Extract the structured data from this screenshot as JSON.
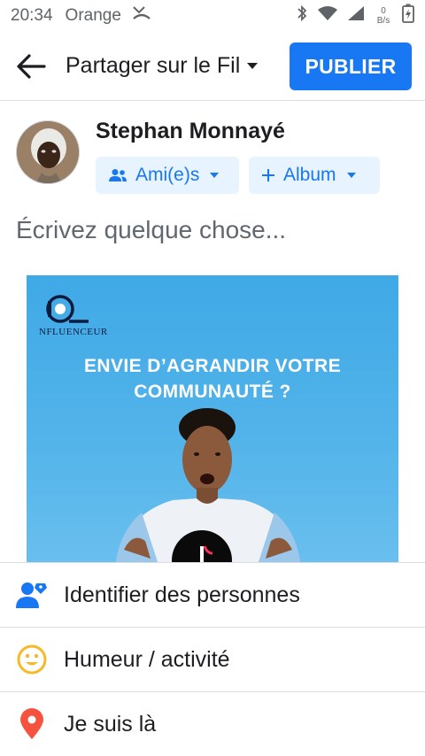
{
  "status_bar": {
    "time": "20:34",
    "carrier": "Orange",
    "net_speed_value": "0",
    "net_speed_unit": "B/s",
    "icons": [
      "missed-call-icon",
      "bluetooth-icon",
      "wifi-icon",
      "signal-icon",
      "battery-charging-icon"
    ]
  },
  "header": {
    "title": "Partager sur le Fil",
    "publish_label": "PUBLIER"
  },
  "author": {
    "name": "Stephan Monnayé",
    "audience_label": "Ami(e)s",
    "album_label": "Album"
  },
  "composer": {
    "placeholder": "Écrivez quelque chose..."
  },
  "attachment": {
    "logo_text": "NFLUENCEUR",
    "headline_line1": "ENVIE D’AGRANDIR VOTRE",
    "headline_line2": "COMMUNAUTÉ ?"
  },
  "actions": [
    {
      "label": "Identifier des personnes",
      "icon": "tag-people-icon",
      "color": "#1877f2"
    },
    {
      "label": "Humeur / activité",
      "icon": "smiley-icon",
      "color": "#f7b928"
    },
    {
      "label": "Je suis là",
      "icon": "location-pin-icon",
      "color": "#f5533d"
    }
  ],
  "colors": {
    "accent": "#1877f2",
    "pill_bg": "#e7f3ff",
    "placeholder": "#606770"
  }
}
